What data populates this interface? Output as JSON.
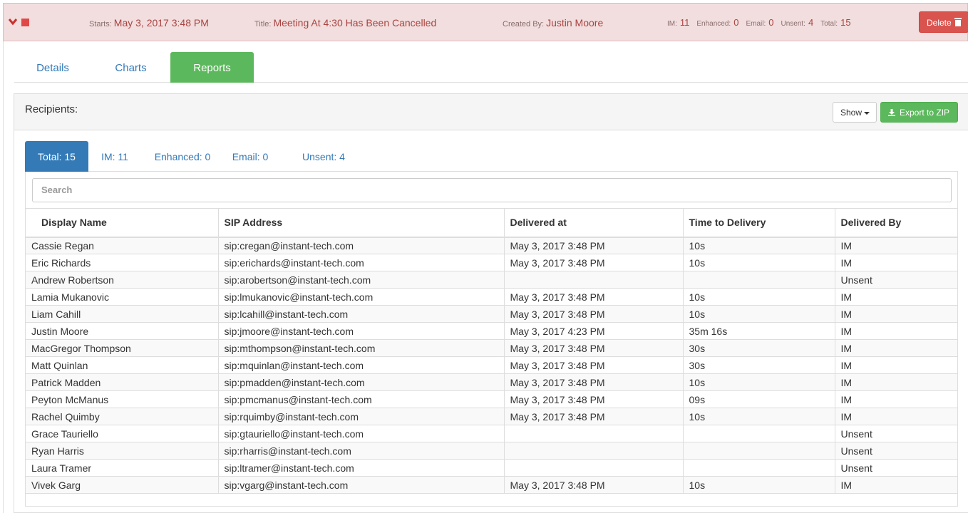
{
  "header": {
    "starts_label": "Starts:",
    "starts_value": "May 3, 2017 3:48 PM",
    "title_label": "Title:",
    "title_value": "Meeting At 4:30 Has Been Cancelled",
    "created_label": "Created By:",
    "created_value": "Justin Moore",
    "counts": [
      {
        "label": "IM:",
        "value": "11"
      },
      {
        "label": "Enhanced:",
        "value": "0"
      },
      {
        "label": "Email:",
        "value": "0"
      },
      {
        "label": "Unsent:",
        "value": "4"
      },
      {
        "label": "Total:",
        "value": "15"
      }
    ],
    "delete_label": "Delete",
    "accent_color": "#d9534f"
  },
  "main_tabs": [
    {
      "label": "Details",
      "active": false
    },
    {
      "label": "Charts",
      "active": false
    },
    {
      "label": "Reports",
      "active": true
    }
  ],
  "panel": {
    "title": "Recipients:",
    "show_label": "Show",
    "export_label": "Export to ZIP"
  },
  "sub_tabs": [
    {
      "label": "Total: 15",
      "active": true
    },
    {
      "label": "IM: 11",
      "active": false
    },
    {
      "label": "Enhanced: 0",
      "active": false
    },
    {
      "label": "Email: 0",
      "active": false
    },
    {
      "label": "Unsent: 4",
      "active": false
    }
  ],
  "search": {
    "placeholder": "Search"
  },
  "table": {
    "columns": [
      "Display Name",
      "SIP Address",
      "Delivered at",
      "Time to Delivery",
      "Delivered By"
    ],
    "rows": [
      [
        "Cassie Regan",
        "sip:cregan@instant-tech.com",
        "May 3, 2017 3:48 PM",
        "10s",
        "IM"
      ],
      [
        "Eric Richards",
        "sip:erichards@instant-tech.com",
        "May 3, 2017 3:48 PM",
        "10s",
        "IM"
      ],
      [
        "Andrew Robertson",
        "sip:arobertson@instant-tech.com",
        "",
        "",
        "Unsent"
      ],
      [
        "Lamia Mukanovic",
        "sip:lmukanovic@instant-tech.com",
        "May 3, 2017 3:48 PM",
        "10s",
        "IM"
      ],
      [
        "Liam Cahill",
        "sip:lcahill@instant-tech.com",
        "May 3, 2017 3:48 PM",
        "10s",
        "IM"
      ],
      [
        "Justin Moore",
        "sip:jmoore@instant-tech.com",
        "May 3, 2017 4:23 PM",
        "35m 16s",
        "IM"
      ],
      [
        "MacGregor Thompson",
        "sip:mthompson@instant-tech.com",
        "May 3, 2017 3:48 PM",
        "30s",
        "IM"
      ],
      [
        "Matt Quinlan",
        "sip:mquinlan@instant-tech.com",
        "May 3, 2017 3:48 PM",
        "30s",
        "IM"
      ],
      [
        "Patrick Madden",
        "sip:pmadden@instant-tech.com",
        "May 3, 2017 3:48 PM",
        "10s",
        "IM"
      ],
      [
        "Peyton McManus",
        "sip:pmcmanus@instant-tech.com",
        "May 3, 2017 3:48 PM",
        "09s",
        "IM"
      ],
      [
        "Rachel Quimby",
        "sip:rquimby@instant-tech.com",
        "May 3, 2017 3:48 PM",
        "10s",
        "IM"
      ],
      [
        "Grace Tauriello",
        "sip:gtauriello@instant-tech.com",
        "",
        "",
        "Unsent"
      ],
      [
        "Ryan Harris",
        "sip:rharris@instant-tech.com",
        "",
        "",
        "Unsent"
      ],
      [
        "Laura Tramer",
        "sip:ltramer@instant-tech.com",
        "",
        "",
        "Unsent"
      ],
      [
        "Vivek Garg",
        "sip:vgarg@instant-tech.com",
        "May 3, 2017 3:48 PM",
        "10s",
        "IM"
      ]
    ]
  }
}
